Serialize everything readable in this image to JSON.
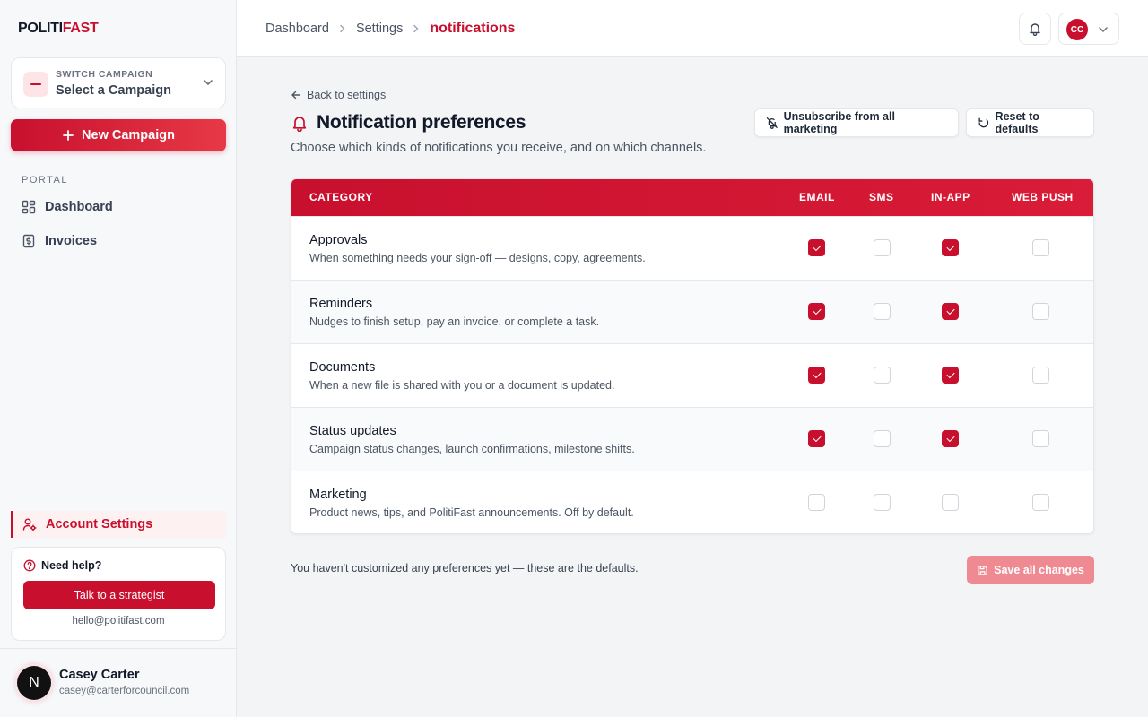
{
  "sidebar": {
    "logo": {
      "part1": "POLITI",
      "part2": "FAST"
    },
    "switch_campaign": {
      "caption": "SWITCH CAMPAIGN",
      "value": "Select a Campaign"
    },
    "new_campaign_label": "New Campaign",
    "portal_label": "PORTAL",
    "nav": [
      {
        "label": "Dashboard",
        "icon": "grid-icon"
      },
      {
        "label": "Invoices",
        "icon": "invoice-icon"
      }
    ],
    "account_settings_label": "Account Settings",
    "help": {
      "title": "Need help?",
      "button": "Talk to a strategist",
      "email": "hello@politifast.com"
    },
    "user": {
      "initial": "N",
      "name": "Casey Carter",
      "email": "casey@carterforcouncil.com"
    }
  },
  "header": {
    "breadcrumbs": [
      "Dashboard",
      "Settings",
      "notifications"
    ],
    "avatar_initials": "CC"
  },
  "main": {
    "back_label": "Back to settings",
    "title": "Notification preferences",
    "subtitle": "Choose which kinds of notifications you receive, and on which channels.",
    "unsubscribe_label": "Unsubscribe from all marketing",
    "reset_label": "Reset to defaults",
    "columns": [
      "CATEGORY",
      "EMAIL",
      "SMS",
      "IN-APP",
      "WEB PUSH"
    ],
    "rows": [
      {
        "name": "Approvals",
        "desc": "When something needs your sign-off — designs, copy, agreements.",
        "checks": [
          true,
          false,
          true,
          false
        ]
      },
      {
        "name": "Reminders",
        "desc": "Nudges to finish setup, pay an invoice, or complete a task.",
        "checks": [
          true,
          false,
          true,
          false
        ]
      },
      {
        "name": "Documents",
        "desc": "When a new file is shared with you or a document is updated.",
        "checks": [
          true,
          false,
          true,
          false
        ]
      },
      {
        "name": "Status updates",
        "desc": "Campaign status changes, launch confirmations, milestone shifts.",
        "checks": [
          true,
          false,
          true,
          false
        ]
      },
      {
        "name": "Marketing",
        "desc": "Product news, tips, and PolitiFast announcements. Off by default.",
        "checks": [
          false,
          false,
          false,
          false
        ]
      }
    ],
    "footer_note": "You haven't customized any preferences yet — these are the defaults.",
    "save_label": "Save all changes"
  },
  "colors": {
    "accent": "#c8102e",
    "save_disabled": "#ef8a93"
  }
}
